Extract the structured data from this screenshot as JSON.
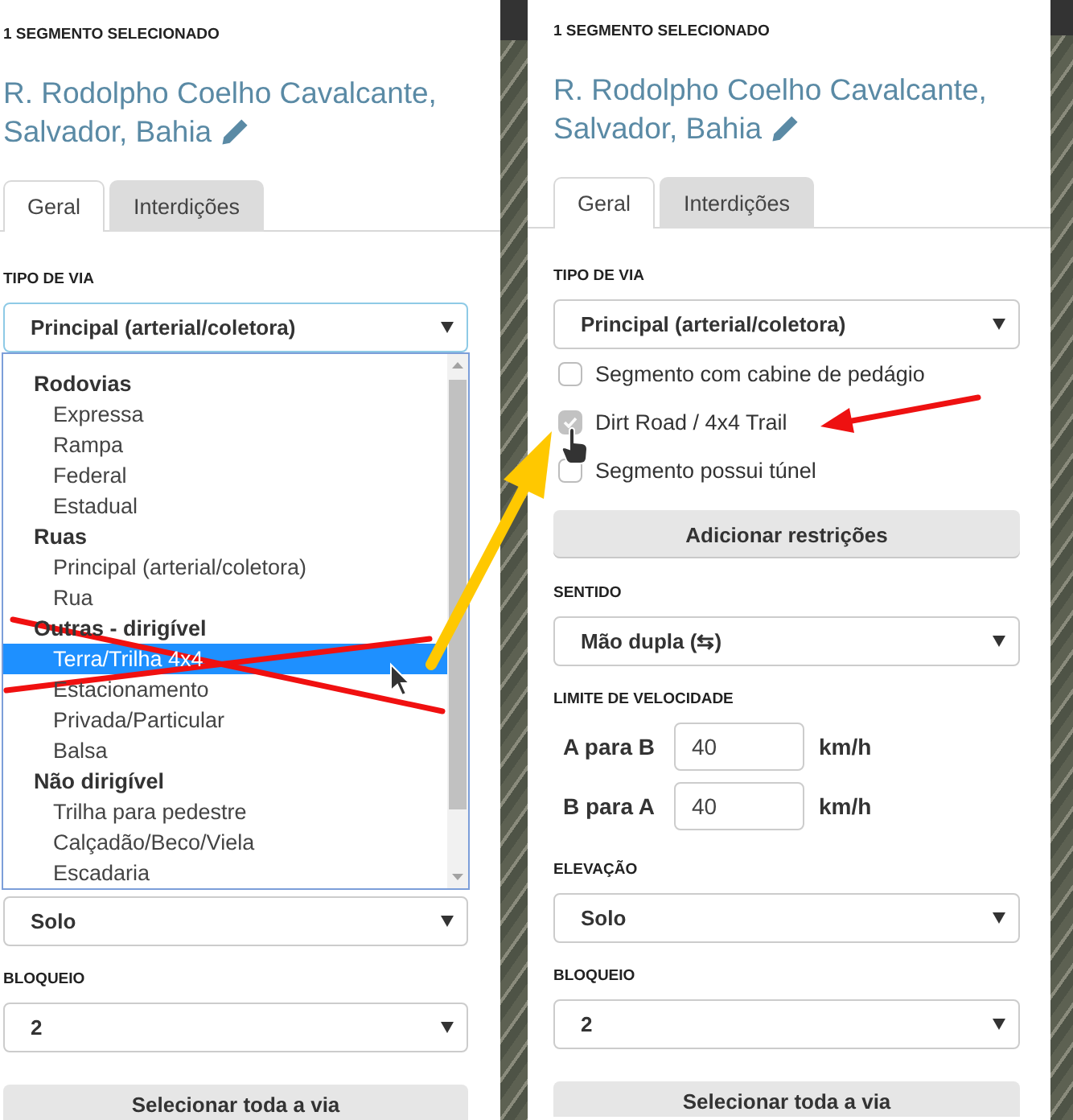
{
  "panels": [
    {
      "header": "1 SEGMENTO SELECIONADO",
      "title_lines": [
        "R. Rodolpho Coelho Cavalcante,",
        "Salvador, Bahia"
      ],
      "tabs": [
        {
          "label": "Geral",
          "selected": true
        },
        {
          "label": "Interdições",
          "selected": false
        }
      ],
      "controls": [
        {
          "kind": "select",
          "label": "TIPO DE VIA",
          "value": "Principal (arterial/coletora)",
          "expanded": true,
          "options": [
            {
              "label": "Rodovias",
              "children": [
                {
                  "label": "Expressa",
                  "selected": false
                },
                {
                  "label": "Rampa",
                  "selected": false
                },
                {
                  "label": "Federal",
                  "selected": false
                },
                {
                  "label": "Estadual",
                  "selected": false
                }
              ]
            },
            {
              "label": "Ruas",
              "children": [
                {
                  "label": "Principal (arterial/coletora)",
                  "selected": false
                },
                {
                  "label": "Rua",
                  "selected": false
                }
              ]
            },
            {
              "label": "Outras - dirigível",
              "children": [
                {
                  "label": "Terra/Trilha 4x4",
                  "selected": true
                },
                {
                  "label": "Estacionamento",
                  "selected": false
                },
                {
                  "label": "Privada/Particular",
                  "selected": false
                },
                {
                  "label": "Balsa",
                  "selected": false
                }
              ]
            },
            {
              "label": "Não dirigível",
              "children": [
                {
                  "label": "Trilha para pedestre",
                  "selected": false
                },
                {
                  "label": "Calçadão/Beco/Viela",
                  "selected": false
                },
                {
                  "label": "Escadaria",
                  "selected": false
                }
              ]
            }
          ]
        },
        {
          "kind": "select",
          "value": "Solo",
          "expanded": false
        },
        {
          "kind": "select",
          "label": "BLOQUEIO",
          "value": "2",
          "expanded": false
        },
        {
          "kind": "button",
          "label": "Selecionar toda a via"
        }
      ]
    },
    {
      "header": "1 SEGMENTO SELECIONADO",
      "title_lines": [
        "R. Rodolpho Coelho Cavalcante,",
        "Salvador, Bahia"
      ],
      "tabs": [
        {
          "label": "Geral",
          "selected": true
        },
        {
          "label": "Interdições",
          "selected": false
        }
      ],
      "controls": [
        {
          "kind": "select",
          "label": "TIPO DE VIA",
          "value": "Principal (arterial/coletora)",
          "expanded": false
        },
        {
          "kind": "checkboxes",
          "items": [
            {
              "label": "Segmento com cabine de pedágio",
              "checked": false,
              "disabled": false
            },
            {
              "label": "Dirt Road / 4x4 Trail",
              "checked": true,
              "disabled": true
            },
            {
              "label": "Segmento possui túnel",
              "checked": false,
              "disabled": false
            }
          ]
        },
        {
          "kind": "button",
          "label": "Adicionar restrições"
        },
        {
          "kind": "select",
          "label": "SENTIDO",
          "value": "Mão dupla (⇆)",
          "expanded": false
        },
        {
          "kind": "speed",
          "label": "LIMITE DE VELOCIDADE",
          "rows": [
            {
              "label": "A para B",
              "value": "40",
              "unit": "km/h"
            },
            {
              "label": "B para A",
              "value": "40",
              "unit": "km/h"
            }
          ]
        },
        {
          "kind": "select",
          "label": "ELEVAÇÃO",
          "value": "Solo",
          "expanded": false
        },
        {
          "kind": "select",
          "label": "BLOQUEIO",
          "value": "2",
          "expanded": false
        },
        {
          "kind": "button",
          "label": "Selecionar toda a via"
        }
      ]
    }
  ]
}
